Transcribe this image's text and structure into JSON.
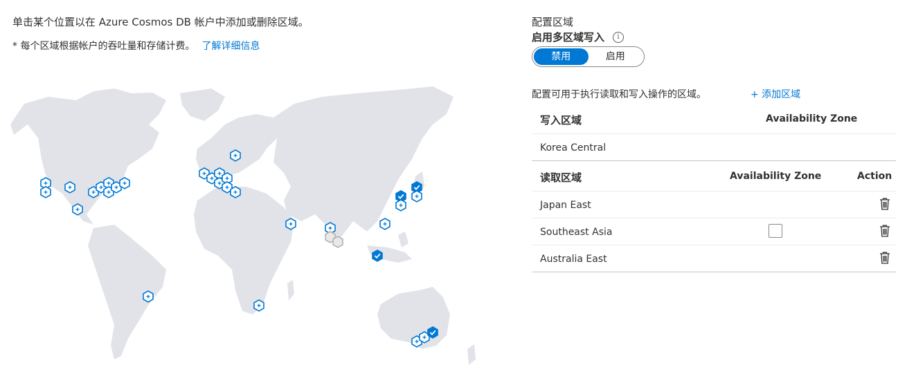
{
  "intro": {
    "text": "单击某个位置以在 Azure Cosmos DB 帐户中添加或删除区域。",
    "note": "* 每个区域根据帐户的吞吐量和存储计费。",
    "learn_more": "了解详细信息"
  },
  "config": {
    "title": "配置区域",
    "multi_write_label": "启用多区域写入",
    "info_icon": "i",
    "toggle": {
      "off": "禁用",
      "on": "启用",
      "selected": "禁用"
    },
    "description": "配置可用于执行读取和写入操作的区域。",
    "add_region": "+ 添加区域"
  },
  "write_table": {
    "header_region": "写入区域",
    "header_az": "Availability Zone",
    "rows": [
      {
        "region": "Korea Central"
      }
    ]
  },
  "read_table": {
    "header_region": "读取区域",
    "header_az": "Availability Zone",
    "header_action": "Action",
    "rows": [
      {
        "region": "Japan East",
        "az_checkbox": false
      },
      {
        "region": "Southeast Asia",
        "az_checkbox": true
      },
      {
        "region": "Australia East",
        "az_checkbox": false
      }
    ]
  },
  "colors": {
    "accent": "#0078d4",
    "map_land": "#e1e3e8",
    "marker_disabled": "#b3b3b3"
  }
}
